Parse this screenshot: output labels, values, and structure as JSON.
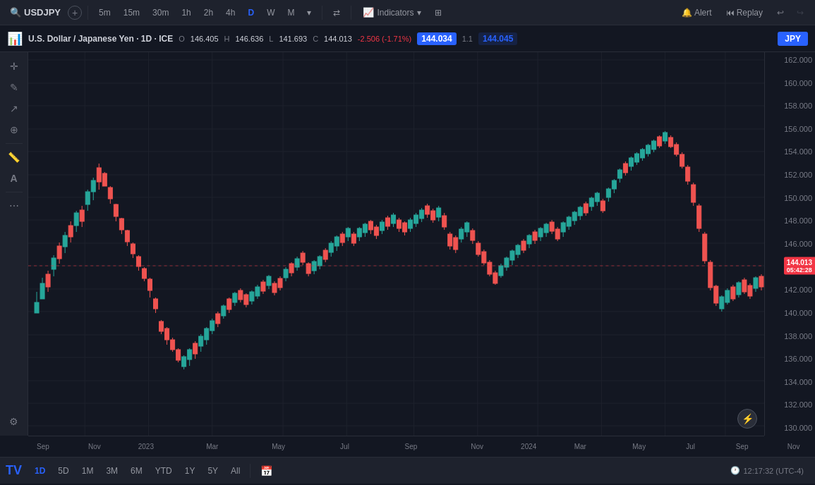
{
  "toolbar": {
    "symbol": "USDJPY",
    "add_symbol_icon": "+",
    "timeframes": [
      "5m",
      "15m",
      "30m",
      "1h",
      "2h",
      "4h",
      "D",
      "W",
      "M"
    ],
    "active_timeframe": "D",
    "compare_icon": "⇄",
    "indicators_label": "Indicators",
    "layout_icon": "⊞",
    "alert_label": "Alert",
    "replay_label": "Replay",
    "undo_icon": "↩",
    "redo_icon": "↪"
  },
  "chart_header": {
    "pair_full": "U.S. Dollar / Japanese Yen",
    "timeframe": "1D",
    "exchange": "ICE",
    "open_label": "O",
    "open_val": "146.405",
    "high_label": "H",
    "high_val": "146.636",
    "low_label": "L",
    "low_val": "141.693",
    "close_label": "C",
    "close_val": "144.013",
    "change_val": "-2.506",
    "change_pct": "-1.71%",
    "current_price_badge": "144.034",
    "spread": "1.1",
    "current_price_blue": "144.045",
    "jpy_button": "JPY"
  },
  "price_axis": {
    "labels": [
      {
        "val": "162.000",
        "pct": 2
      },
      {
        "val": "160.000",
        "pct": 8
      },
      {
        "val": "158.000",
        "pct": 14
      },
      {
        "val": "156.000",
        "pct": 20
      },
      {
        "val": "154.000",
        "pct": 26
      },
      {
        "val": "152.000",
        "pct": 32
      },
      {
        "val": "150.000",
        "pct": 38
      },
      {
        "val": "148.000",
        "pct": 44
      },
      {
        "val": "146.000",
        "pct": 50
      },
      {
        "val": "144.000",
        "pct": 56
      },
      {
        "val": "142.000",
        "pct": 62
      },
      {
        "val": "140.000",
        "pct": 68
      },
      {
        "val": "138.000",
        "pct": 74
      },
      {
        "val": "136.000",
        "pct": 80
      },
      {
        "val": "134.000",
        "pct": 86
      },
      {
        "val": "132.000",
        "pct": 92
      },
      {
        "val": "130.000",
        "pct": 98
      }
    ],
    "current_price": "144.013",
    "current_time": "05:42:28",
    "current_pct": 56
  },
  "time_axis": {
    "labels": [
      {
        "text": "Sep",
        "pct": 2
      },
      {
        "text": "Nov",
        "pct": 9
      },
      {
        "text": "2023",
        "pct": 16
      },
      {
        "text": "Mar",
        "pct": 25
      },
      {
        "text": "May",
        "pct": 34
      },
      {
        "text": "Jul",
        "pct": 43
      },
      {
        "text": "Sep",
        "pct": 52
      },
      {
        "text": "Nov",
        "pct": 61
      },
      {
        "text": "2024",
        "pct": 68
      },
      {
        "text": "Mar",
        "pct": 75
      },
      {
        "text": "May",
        "pct": 83
      },
      {
        "text": "Jul",
        "pct": 90
      },
      {
        "text": "Sep",
        "pct": 97
      },
      {
        "text": "Nov",
        "pct": 104
      }
    ]
  },
  "bottom_toolbar": {
    "timeframes": [
      "1D",
      "5D",
      "1M",
      "3M",
      "6M",
      "YTD",
      "1Y",
      "5Y",
      "All"
    ],
    "active": "1D",
    "calendar_icon": "📅",
    "clock_text": "12:17:32 (UTC-4)",
    "lightning_icon": "⚡"
  },
  "left_toolbar": {
    "tools": [
      "✎",
      "↗",
      "⊕",
      "⊘",
      "📏",
      "Aa",
      "⋮"
    ]
  }
}
